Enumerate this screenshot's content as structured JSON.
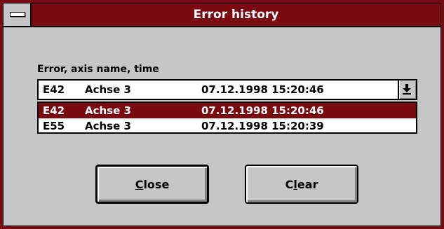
{
  "window": {
    "title": "Error history",
    "colors": {
      "titlebar": "#7a0a10",
      "face": "#c6c6c6",
      "selection": "#7a0a10"
    }
  },
  "field_label": "Error, axis name, time",
  "combo": {
    "selected": {
      "code": "E42",
      "axis": "Achse 3",
      "time": "07.12.1998 15:20:46"
    },
    "arrow_icon": "dropdown-arrow-icon"
  },
  "list": {
    "items": [
      {
        "code": "E42",
        "axis": "Achse 3",
        "time": "07.12.1998 15:20:46",
        "selected": true
      },
      {
        "code": "E55",
        "axis": "Achse 3",
        "time": "07.12.1998 15:20:39",
        "selected": false
      }
    ]
  },
  "buttons": {
    "close": {
      "mnemonic": "C",
      "rest": "lose"
    },
    "clear": {
      "pre": "C",
      "mnemonic": "l",
      "rest": "ear"
    }
  }
}
